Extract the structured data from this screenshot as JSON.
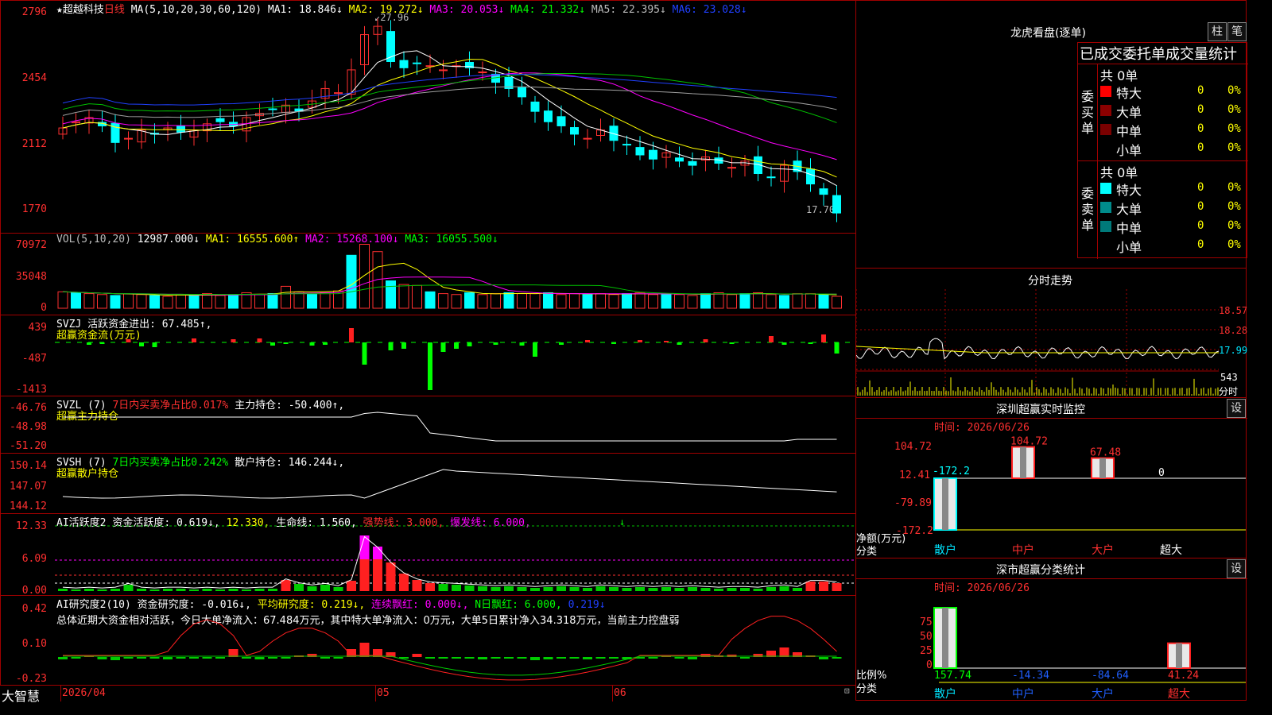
{
  "stock": {
    "name": "超越科技",
    "period": "日线"
  },
  "main_chart": {
    "ma_header": "MA(5,10,20,30,60,120)",
    "ma1": "MA1: 18.846↓",
    "ma2": "MA2: 19.272↓",
    "ma3": "MA3: 20.053↓",
    "ma4": "MA4: 21.332↓",
    "ma5": "MA5: 22.395↓",
    "ma6": "MA6: 23.028↓",
    "y_labels": [
      "2796",
      "2454",
      "2112",
      "1770"
    ],
    "high_label": "27.96",
    "low_label": "17.70"
  },
  "vol_panel": {
    "header": "VOL(5,10,20)",
    "value": "12987.000↓",
    "ma1": "MA1: 16555.600↑",
    "ma2": "MA2: 15268.100↓",
    "ma3": "MA3: 16055.500↓",
    "y_labels": [
      "70972",
      "35048",
      "0"
    ]
  },
  "svzj_panel": {
    "header": "SVZJ  活跃资金进出: 67.485↑,",
    "sub": "超赢资金流(万元)",
    "y_labels": [
      "439",
      "-487",
      "-1413"
    ]
  },
  "svzl_panel": {
    "header": "SVZL (7)",
    "ratio": "7日内买卖净占比0.017%",
    "hold": "主力持仓: -50.400↑,",
    "sub": "超赢主力持仓",
    "y_labels": [
      "-46.76",
      "-48.98",
      "-51.20"
    ]
  },
  "svsh_panel": {
    "header": "SVSH (7)",
    "ratio": "7日内买卖净占比0.242%",
    "hold": "散户持仓: 146.244↓,",
    "sub": "超赢散户持仓",
    "y_labels": [
      "150.14",
      "147.07",
      "144.12"
    ]
  },
  "ai1_panel": {
    "header": "AI活跃度2",
    "a": "资金活跃度: 0.619↓,",
    "b": "12.330,",
    "c": "生命线: 1.560,",
    "d": "强势线: 3.000,",
    "e": "爆发线: 6.000,",
    "y_labels": [
      "12.33",
      "6.09",
      "0.00"
    ]
  },
  "ai2_panel": {
    "header": "AI研究度2(10)",
    "a": "资金研究度: -0.016↓,",
    "b": "平均研究度: 0.219↓,",
    "c": "连续飘红: 0.000↓,",
    "d": "N日飘红: 6.000,",
    "e": "0.219↓",
    "summary": "总体近期大资金相对活跃，今日大单净流入：67.484万元，其中特大单净流入：0万元，大单5日累计净入34.318万元，当前主力控盘弱",
    "y_labels": [
      "0.42",
      "0.10",
      "-0.23"
    ]
  },
  "footer": {
    "brand": "大智慧",
    "date": "2026/04",
    "m05": "05",
    "m06": "06"
  },
  "dragon": {
    "title": "龙虎看盘(逐单)",
    "btn1": "柱",
    "btn2": "笔",
    "subtitle": "已成交委托单成交量统计",
    "buy_label": "委买单",
    "sell_label": "委卖单",
    "buy_total": "共 0单",
    "sell_total": "共 0单",
    "rows": [
      {
        "n": "特大",
        "v": "0",
        "p": "0%"
      },
      {
        "n": "大单",
        "v": "0",
        "p": "0%"
      },
      {
        "n": "中单",
        "v": "0",
        "p": "0%"
      },
      {
        "n": "小单",
        "v": "0",
        "p": "0%"
      }
    ],
    "buy_colors": [
      "#ff0000",
      "#8b0000",
      "#7a0000",
      "#000000"
    ],
    "sell_colors": [
      "#00ffff",
      "#008b8b",
      "#007a7a",
      "#000000"
    ]
  },
  "intraday": {
    "title": "分时走势",
    "y_labels": [
      "18.57",
      "18.28",
      "17.99"
    ],
    "vol": "543",
    "vol_lbl": "分时"
  },
  "sz_monitor": {
    "title": "深圳超赢实时监控",
    "btn": "设",
    "time": "时间: 2026/06/26",
    "y_labels": [
      "104.72",
      "12.41",
      "-79.89",
      "-172.2"
    ],
    "values": [
      "-172.2",
      "104.72",
      "67.48",
      "0"
    ],
    "unit": "净额(万元)",
    "cat": "分类",
    "cats": [
      "散户",
      "中户",
      "大户",
      "超大"
    ]
  },
  "sz_class": {
    "title": "深市超赢分类统计",
    "btn": "设",
    "time": "时间: 2026/06/26",
    "y_labels": [
      "75",
      "50",
      "25",
      "0"
    ],
    "values": [
      "157.74",
      "-14.34",
      "-84.64",
      "41.24"
    ],
    "unit": "比例%",
    "cat": "分类",
    "cats": [
      "散户",
      "中户",
      "大户",
      "超大"
    ]
  }
}
